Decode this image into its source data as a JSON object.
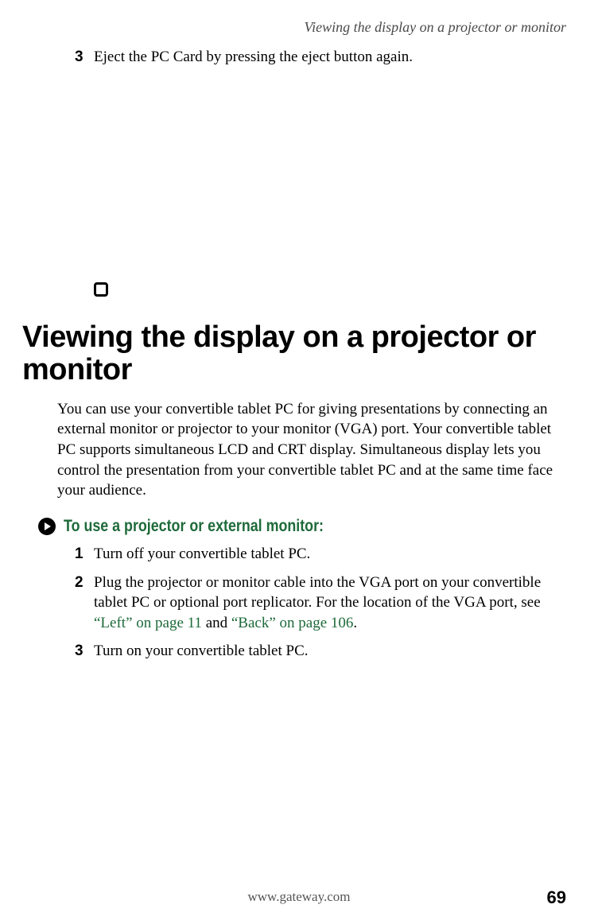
{
  "running_head": "Viewing the display on a projector or monitor",
  "prev_step": {
    "num": "3",
    "text": "Eject the PC Card by pressing the eject button again."
  },
  "section_heading": "Viewing the display on a projector or monitor",
  "intro_para": "You can use your convertible tablet PC for giving presentations by connecting an external monitor or projector to your monitor (VGA) port. Your convertible tablet PC supports simultaneous LCD and CRT display. Simultaneous display lets you control the presentation from your convertible tablet PC and at the same time face your audience.",
  "procedure_title": "To use a projector or external monitor:",
  "steps": [
    {
      "num": "1",
      "text": "Turn off your convertible tablet PC."
    },
    {
      "num": "2",
      "text_before": "Plug the projector or monitor cable into the VGA port on your convertible tablet PC or optional port replicator. For the location of the VGA port, see ",
      "link1": "“Left” on page 11",
      "mid": " and ",
      "link2": "“Back” on page 106",
      "after": "."
    },
    {
      "num": "3",
      "text": "Turn on your convertible tablet PC."
    }
  ],
  "footer_url": "www.gateway.com",
  "page_number": "69"
}
